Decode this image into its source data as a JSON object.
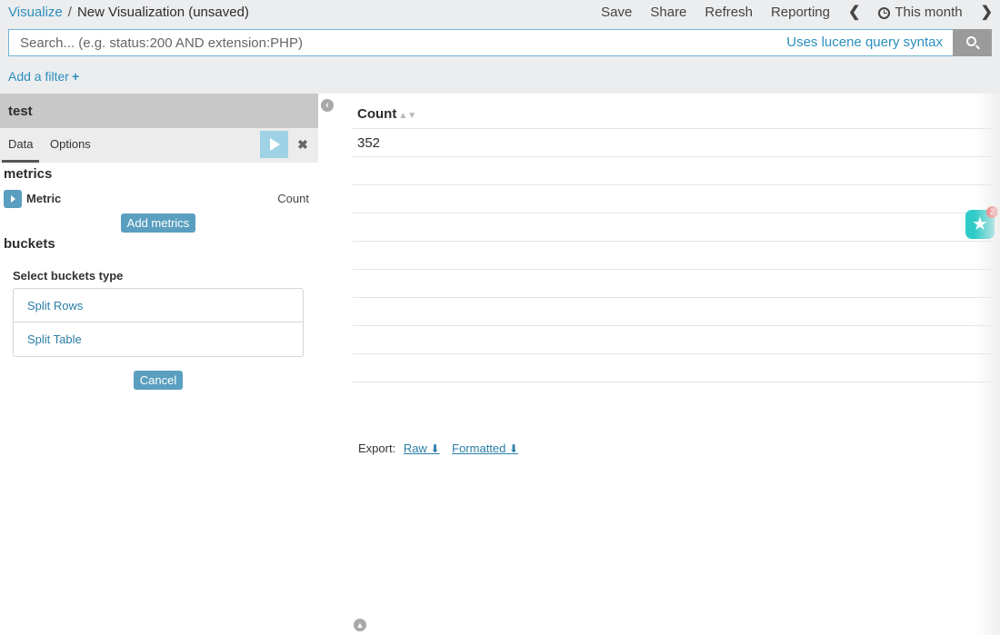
{
  "breadcrumb": {
    "parent": "Visualize",
    "separator": "/",
    "current": "New Visualization (unsaved)"
  },
  "menu": {
    "save": "Save",
    "share": "Share",
    "refresh": "Refresh",
    "reporting": "Reporting",
    "time_range": "This month"
  },
  "search": {
    "placeholder": "Search... (e.g. status:200 AND extension:PHP)",
    "value": "",
    "syntax_hint": "Uses lucene query syntax"
  },
  "filter": {
    "add_label": "Add a filter",
    "plus": "+"
  },
  "sidebar": {
    "title": "test",
    "tabs": [
      "Data",
      "Options"
    ],
    "metrics_title": "metrics",
    "metric": {
      "label": "Metric",
      "value": "Count"
    },
    "add_metrics_label": "Add metrics",
    "buckets_title": "buckets",
    "select_buckets_label": "Select buckets type",
    "bucket_types": [
      "Split Rows",
      "Split Table"
    ],
    "cancel_label": "Cancel"
  },
  "table": {
    "columns": [
      "Count"
    ],
    "rows": [
      [
        "352"
      ]
    ]
  },
  "export": {
    "label": "Export:",
    "raw": "Raw",
    "formatted": "Formatted"
  },
  "notification": {
    "count": "2"
  },
  "colors": {
    "accent": "#2a8fbd",
    "button": "#5a9fc0",
    "fab": "#2fcbc6",
    "badge": "#e8433f"
  }
}
